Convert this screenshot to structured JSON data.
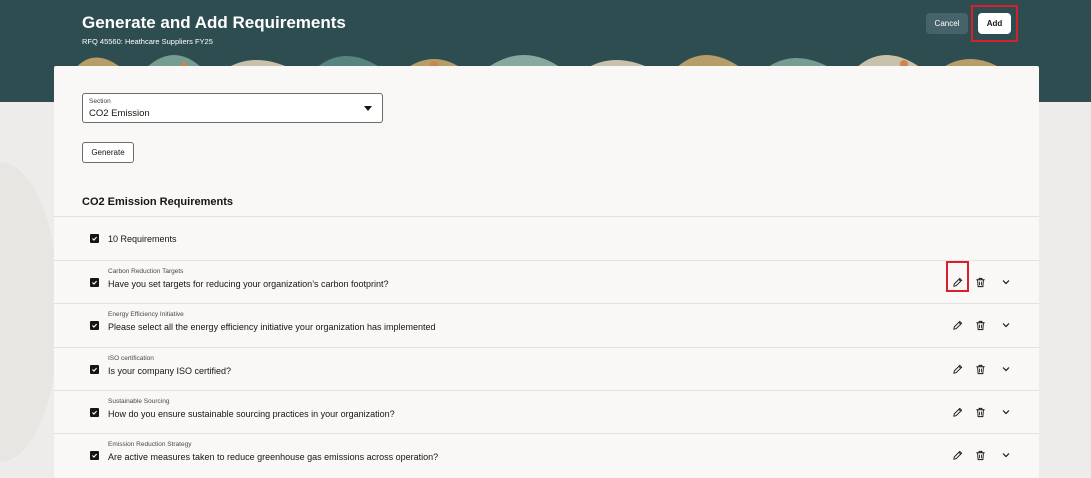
{
  "header": {
    "title": "Generate and Add Requirements",
    "subtitle": "RFQ 45560: Heathcare Suppliers FY25",
    "cancel_label": "Cancel",
    "add_label": "Add"
  },
  "form": {
    "section_label": "Section",
    "section_value": "CO2 Emission",
    "generate_label": "Generate"
  },
  "requirements": {
    "heading": "CO2 Emission Requirements",
    "count_label": "10 Requirements",
    "items": [
      {
        "category": "Carbon Reduction Targets",
        "question": "Have you set targets for reducing your organization’s carbon footprint?"
      },
      {
        "category": "Energy Efficiency Initiative",
        "question": "Please select all the energy efficiency initiative your organization has implemented"
      },
      {
        "category": "ISO certification",
        "question": "Is your company ISO certified?"
      },
      {
        "category": "Sustainable Sourcing",
        "question": "How do you ensure sustainable sourcing practices in your organization?"
      },
      {
        "category": "Emission Reduction Strategy",
        "question": "Are active measures taken to reduce greenhouse gas emissions across operation?"
      }
    ]
  },
  "icons": {
    "edit": "pencil-icon",
    "delete": "trash-icon",
    "expand": "chevron-down-icon",
    "dropdown": "caret-down-icon"
  },
  "colors": {
    "header_bg": "#2e4d50",
    "highlight": "#d6202c"
  }
}
